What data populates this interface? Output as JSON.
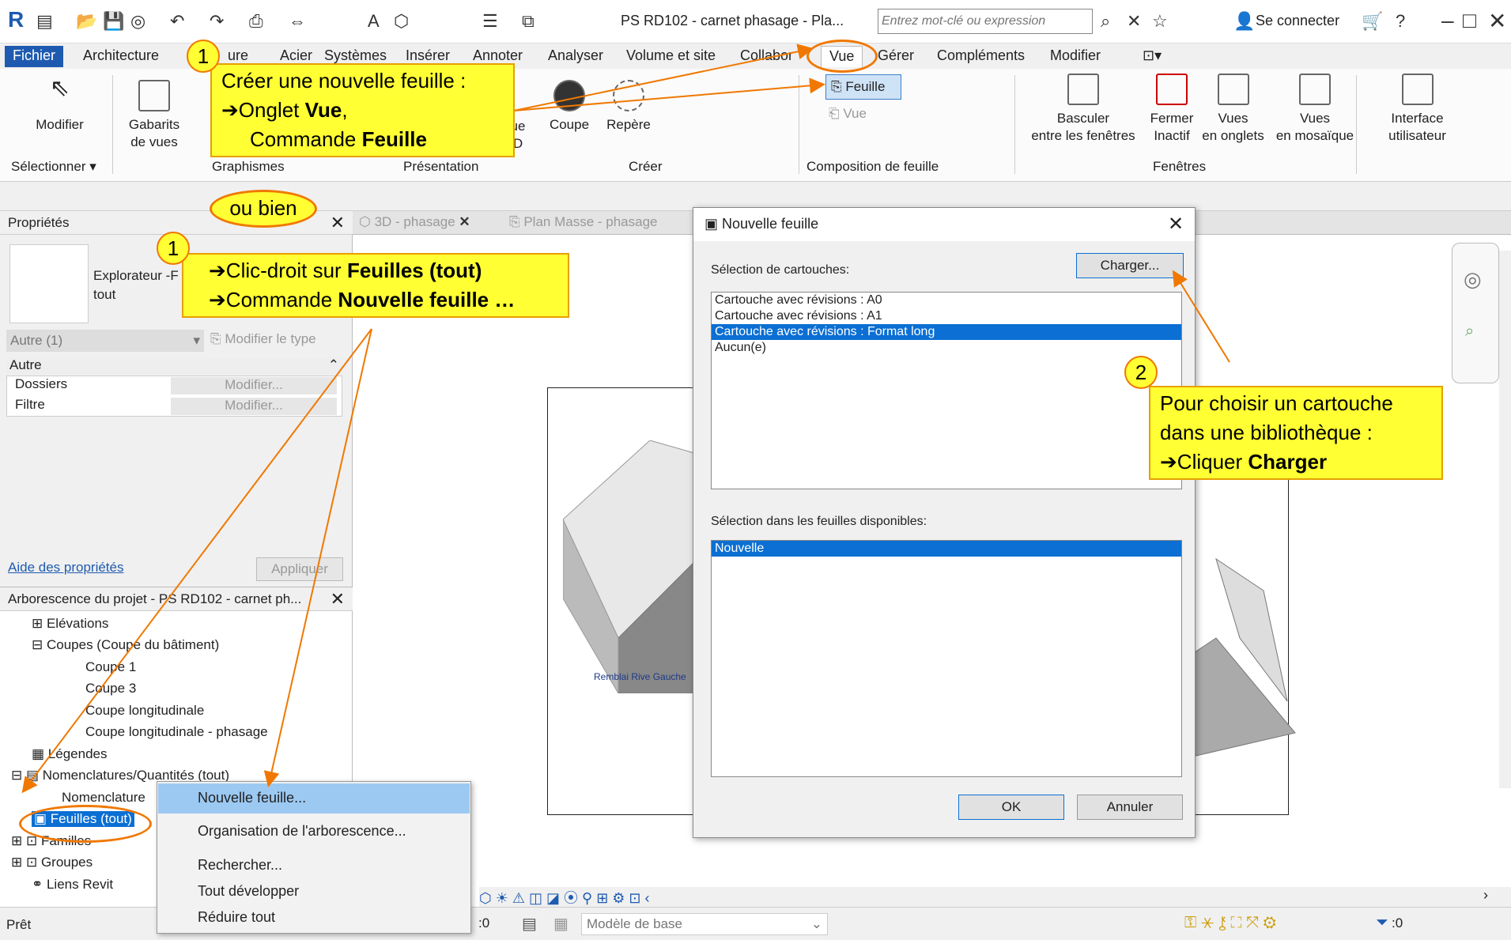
{
  "titlebar": {
    "doc_title": "PS RD102 - carnet phasage - Pla...",
    "search_placeholder": "Entrez mot-clé ou expression",
    "signin": "Se connecter"
  },
  "ribbon_tabs": [
    "Fichier",
    "Architecture",
    "ure",
    "Acier",
    "Systèmes",
    "Insérer",
    "Annoter",
    "Analyser",
    "Volume et site",
    "Collabor",
    "Vue",
    "Gérer",
    "Compléments",
    "Modifier"
  ],
  "ribbon": {
    "modifier": "Modifier",
    "gabarits": "Gabarits",
    "de_vues": "de vues",
    "ue": "ue",
    "d": "D",
    "coupe": "Coupe",
    "repere": "Repère",
    "feuille": "Feuille",
    "vue": "Vue",
    "basculer": "Basculer",
    "entre_fenetres": "entre les fenêtres",
    "fermer": "Fermer",
    "inactif": "Inactif",
    "vues1": "Vues",
    "en_onglets": "en onglets",
    "vues2": "Vues",
    "en_mosaique": "en mosaïque",
    "interface": "Interface",
    "utilisateur": "utilisateur",
    "panels": {
      "selectionner": "Sélectionner",
      "graphismes": "Graphismes",
      "presentation": "Présentation",
      "creer": "Créer",
      "composition": "Composition de feuille",
      "fenetres": "Fenêtres"
    }
  },
  "props": {
    "title": "Propriétés",
    "explorer": "Explorateur -F",
    "tout": "tout",
    "autre_sel": "Autre (1)",
    "modifier_type": "Modifier le type",
    "autre": "Autre",
    "dossiers": "Dossiers",
    "filtre": "Filtre",
    "modifier_btn": "Modifier...",
    "aide": "Aide des propriétés",
    "appliquer": "Appliquer"
  },
  "tree": {
    "title": "Arborescence du projet - PS RD102 - carnet ph...",
    "items": [
      "Elévations",
      "Coupes (Coupe du bâtiment)",
      "Coupe 1",
      "Coupe 3",
      "Coupe longitudinale",
      "Coupe longitudinale - phasage",
      "Légendes",
      "Nomenclatures/Quantités (tout)",
      "Nomenclature",
      "Feuilles (tout)",
      "Familles",
      "Groupes",
      "Liens Revit"
    ]
  },
  "viewtabs": {
    "tab1": "3D - phasage",
    "tab2": "Plan Masse - phasage"
  },
  "view": {
    "label": "Remblai Rive Gauche"
  },
  "dialog": {
    "title": "Nouvelle feuille",
    "sel_cartouches": "Sélection de cartouches:",
    "charger": "Charger...",
    "cartouches": [
      "Cartouche avec révisions : A0",
      "Cartouche avec révisions : A1",
      "Cartouche avec révisions : Format long",
      "Aucun(e)"
    ],
    "sel_feuilles": "Sélection dans les feuilles disponibles:",
    "feuilles": [
      "Nouvelle"
    ],
    "ok": "OK",
    "annuler": "Annuler"
  },
  "ctxmenu": [
    "Nouvelle feuille...",
    "Organisation de l'arborescence...",
    "Rechercher...",
    "Tout développer",
    "Réduire tout"
  ],
  "status": {
    "pret": "Prêt",
    "zero": ":0",
    "modele": "Modèle de base",
    "filter_count": ":0"
  },
  "callouts": {
    "c1a_line1": "Créer une nouvelle feuille :",
    "c1a_arrow1": "➔",
    "c1a_onglet": "Onglet ",
    "c1a_vue": "Vue",
    ",": ",",
    "c1a_commande": "Commande ",
    "c1a_feuille": "Feuille",
    "ou_bien": "ou bien",
    "c1b_arrow": "➔",
    "c1b_l1a": "Clic-droit sur ",
    "c1b_l1b": "Feuilles (tout)",
    "c1b_l2a": "Commande ",
    "c1b_l2b": "Nouvelle feuille …",
    "c2_l1": "Pour choisir un cartouche",
    "c2_l2": "dans une bibliothèque :",
    "c2_arrow": "➔",
    "c2_l3a": "Cliquer ",
    "c2_l3b": "Charger",
    "n1": "1",
    "n2": "2"
  }
}
